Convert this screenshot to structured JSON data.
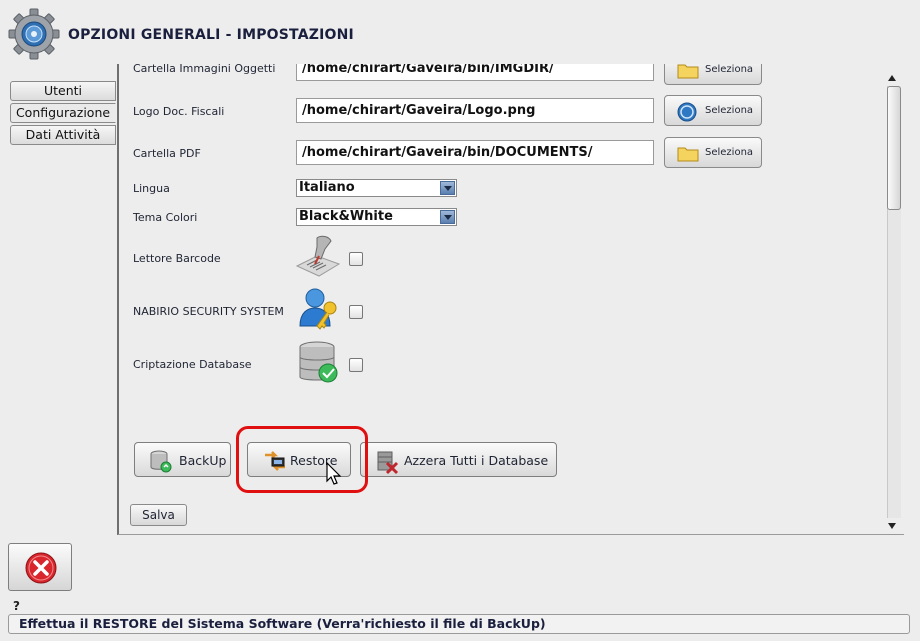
{
  "window": {
    "title": "OPZIONI GENERALI - IMPOSTAZIONI"
  },
  "tabs": [
    {
      "label": "Utenti",
      "active": false
    },
    {
      "label": "Configurazione",
      "active": true
    },
    {
      "label": "Dati Attività",
      "active": false
    }
  ],
  "settings": {
    "rows": [
      {
        "label": "Cartella Immagini Oggetti",
        "value": "/home/chirart/Gaveira/bin/IMGDIR/",
        "button": "Seleziona",
        "icon": "folder-icon"
      },
      {
        "label": "Logo Doc. Fiscali",
        "value": "/home/chirart/Gaveira/Logo.png",
        "button": "Seleziona",
        "icon": "logo-icon"
      },
      {
        "label": "Cartella PDF",
        "value": "/home/chirart/Gaveira/bin/DOCUMENTS/",
        "button": "Seleziona",
        "icon": "folder-icon"
      }
    ],
    "language": {
      "label": "Lingua",
      "value": "Italiano"
    },
    "theme": {
      "label": "Tema Colori",
      "value": "Black&White"
    },
    "barcode": {
      "label": "Lettore Barcode",
      "checked": false,
      "icon": "barcode-reader-icon"
    },
    "security": {
      "label": "NABIRIO SECURITY SYSTEM",
      "checked": false,
      "icon": "user-key-icon"
    },
    "encryption": {
      "label": "Criptazione Database",
      "checked": false,
      "icon": "database-shield-icon"
    }
  },
  "actions": {
    "backup": "BackUp",
    "restore": "Restore",
    "reset": "Azzera Tutti i Database",
    "save": "Salva"
  },
  "footer": {
    "question_mark": "?",
    "status": "Effettua il RESTORE del Sistema Software (Verra'richiesto il file di BackUp)"
  },
  "colors": {
    "highlight": "#e01010",
    "close_red": "#d9262c",
    "title_text": "#1a1f3d"
  }
}
